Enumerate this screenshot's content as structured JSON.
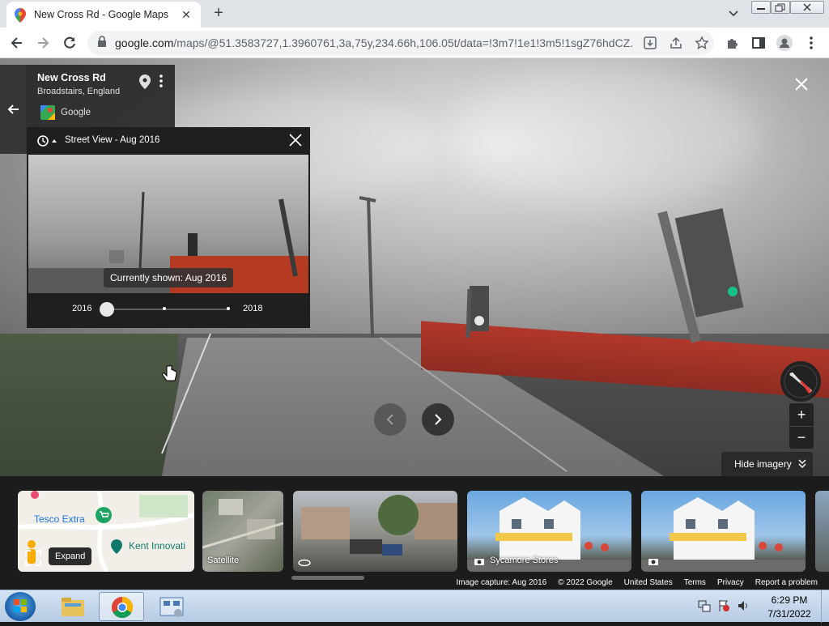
{
  "browser": {
    "tab_title": "New Cross Rd - Google Maps",
    "url_host": "google.com",
    "url_rest": "/maps/@51.3583727,1.3960761,3a,75y,234.66h,106.05t/data=!3m7!1e1!3m5!1sgZ76hdCZ..."
  },
  "place": {
    "name": "New Cross Rd",
    "subtitle": "Broadstairs, England",
    "provider": "Google"
  },
  "time_machine": {
    "title": "Street View - Aug 2016",
    "currently_shown": "Currently shown: Aug 2016",
    "year_start": "2016",
    "year_end": "2018"
  },
  "controls": {
    "hide_imagery": "Hide imagery"
  },
  "strip": {
    "map_tesco": "Tesco Extra",
    "map_kent": "Kent Innovati",
    "expand_tooltip": "Expand",
    "satellite_label": "Satellite",
    "sycamore_label": "Sycamore Stores"
  },
  "credits": {
    "capture": "Image capture: Aug 2016",
    "copyright": "© 2022 Google",
    "country": "United States",
    "terms": "Terms",
    "privacy": "Privacy",
    "report": "Report a problem"
  },
  "taskbar": {
    "time": "6:29 PM",
    "date": "7/31/2022"
  }
}
